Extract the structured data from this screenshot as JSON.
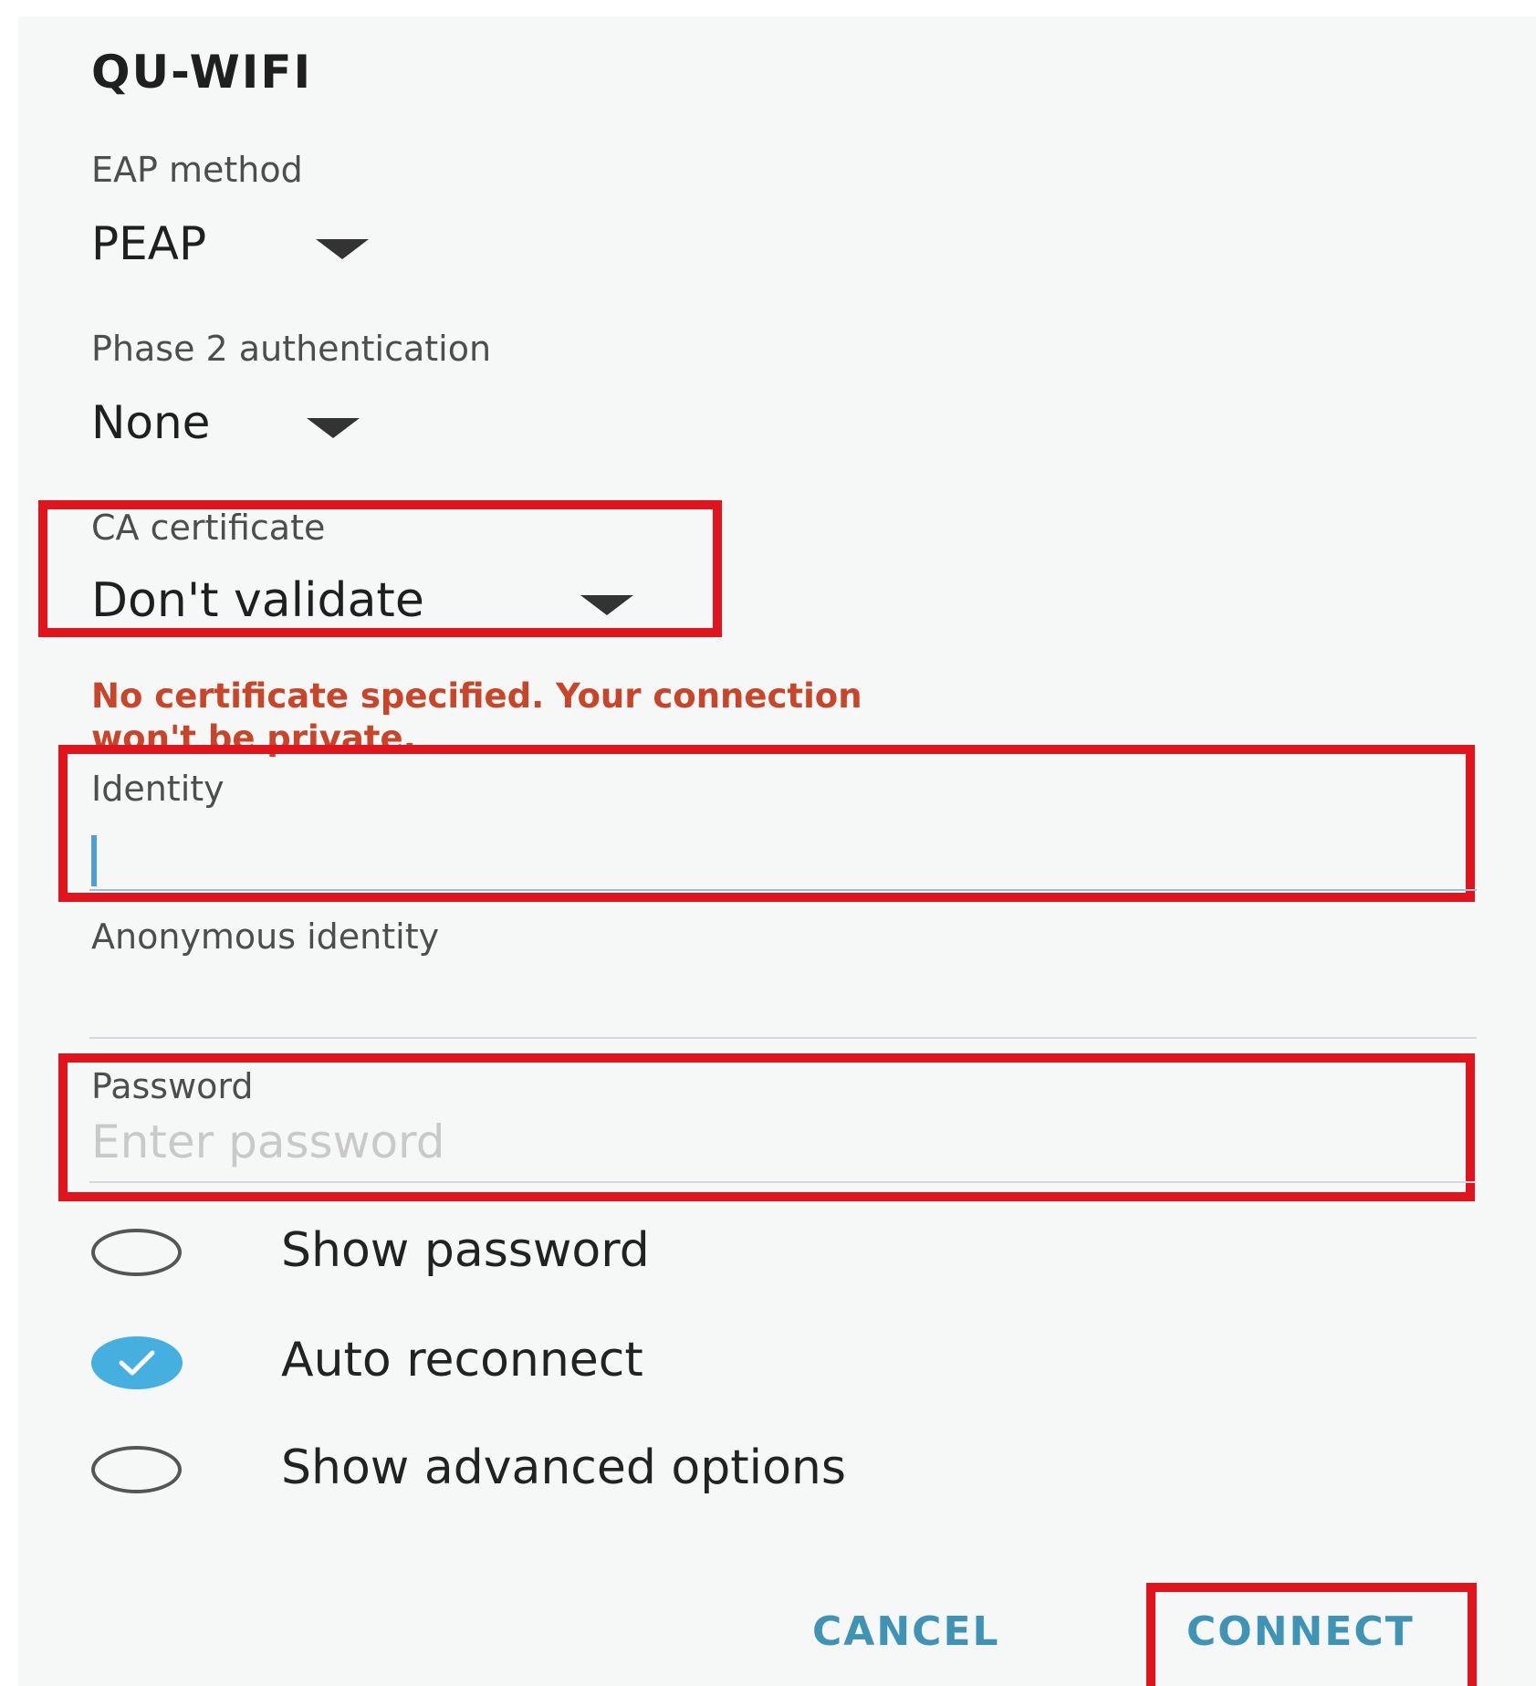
{
  "dialog": {
    "title": "QU-WIFI"
  },
  "fields": {
    "eap_method": {
      "label": "EAP method",
      "value": "PEAP"
    },
    "phase2": {
      "label": "Phase 2 authentication",
      "value": "None"
    },
    "ca_certificate": {
      "label": "CA certificate",
      "value": "Don't validate"
    },
    "warning_line1": "No certificate specified. Your connection",
    "warning_line2": "won't be private.",
    "identity": {
      "label": "Identity",
      "value": ""
    },
    "anonymous_identity": {
      "label": "Anonymous identity",
      "value": ""
    },
    "password": {
      "label": "Password",
      "placeholder": "Enter password"
    }
  },
  "options": {
    "show_password": {
      "label": "Show password",
      "checked": false
    },
    "auto_reconnect": {
      "label": "Auto reconnect",
      "checked": true
    },
    "show_advanced": {
      "label": "Show advanced options",
      "checked": false
    }
  },
  "buttons": {
    "cancel": "CANCEL",
    "connect": "CONNECT"
  },
  "colors": {
    "highlight": "#e1141e",
    "accent": "#45b0e0",
    "warning": "#c8452a",
    "button_text": "#3f93b5"
  },
  "icons": {
    "dropdown": "triangle-down-icon",
    "checkmark": "checkmark-icon"
  }
}
